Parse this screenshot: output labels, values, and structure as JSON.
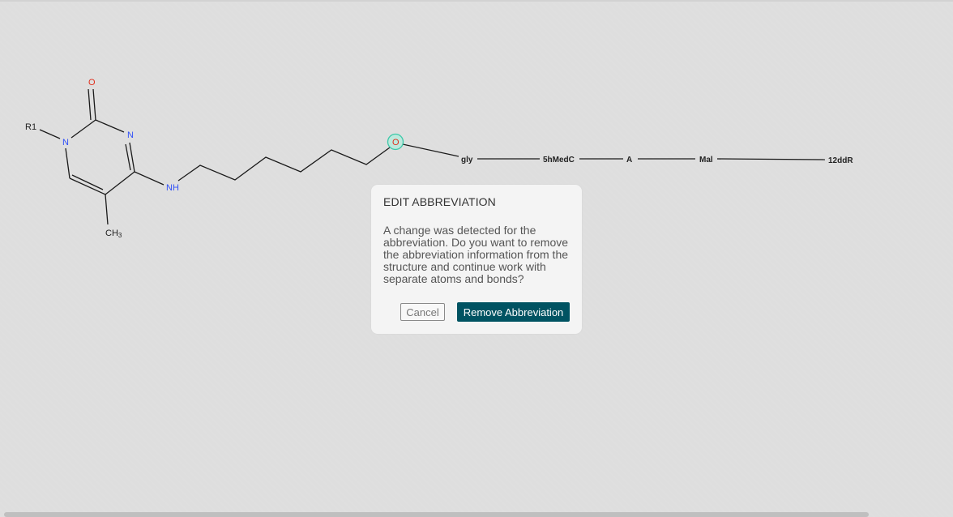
{
  "structure": {
    "atoms": {
      "r1": "R1",
      "n1": "N",
      "n3": "N",
      "o2": "O",
      "nh": "NH",
      "ch3": "CH",
      "ch3_sub": "3",
      "o_link": "O"
    },
    "abbreviations": [
      "gly",
      "5hMedC",
      "A",
      "Mal",
      "12ddR"
    ],
    "colors": {
      "nitrogen": "#3050f8",
      "oxygen": "#e0301e",
      "selection": "#3cc8a8"
    }
  },
  "dialog": {
    "title": "EDIT ABBREVIATION",
    "message": "A change was detected for the abbreviation. Do you want to remove the abbreviation information from the structure and continue work with separate atoms and bonds?",
    "cancel_label": "Cancel",
    "remove_label": "Remove Abbreviation",
    "accent_color": "#005362"
  }
}
